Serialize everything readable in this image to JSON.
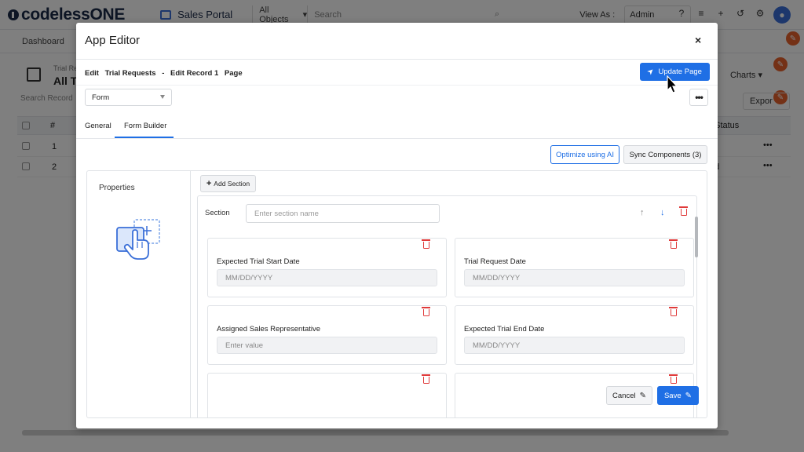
{
  "app": {
    "brand": "codelessONE",
    "app_name": "Sales Portal",
    "object_selector": "All Objects",
    "search_placeholder": "Search",
    "view_as_label": "View As :",
    "view_as_value": "Admin"
  },
  "nav": {
    "dashboard": "Dashboard"
  },
  "page": {
    "subtitle": "Trial Re",
    "title": "All Tr",
    "charts": "Charts",
    "search_placeholder": "Search Record",
    "export": "Expor",
    "columns": {
      "num": "#",
      "status": "t Status"
    },
    "rows": [
      {
        "num": "1",
        "status": "g"
      },
      {
        "num": "2",
        "status": "ed"
      }
    ]
  },
  "modal": {
    "title": "App Editor",
    "close": "×",
    "breadcrumb": [
      "Edit",
      "Trial Requests",
      "-",
      "Edit Record 1",
      "Page"
    ],
    "update_button": "Update Page",
    "form_select": "Form",
    "more": "•••",
    "tabs": [
      {
        "label": "General",
        "active": false
      },
      {
        "label": "Form Builder",
        "active": true
      }
    ],
    "optimize_button": "Optimize using AI",
    "sync_button": "Sync Components (3)",
    "properties_title": "Properties",
    "add_section": "Add Section",
    "section_label": "Section",
    "section_placeholder": "Enter section name",
    "fields": [
      {
        "label": "Expected Trial Start Date",
        "placeholder": "MM/DD/YYYY"
      },
      {
        "label": "Trial Request Date",
        "placeholder": "MM/DD/YYYY"
      },
      {
        "label": "Assigned Sales Representative",
        "placeholder": "Enter value"
      },
      {
        "label": "Expected Trial End Date",
        "placeholder": "MM/DD/YYYY"
      }
    ],
    "cancel_button": "Cancel",
    "save_button": "Save"
  },
  "colors": {
    "primary": "#1f6fe5",
    "danger": "#e03a3a",
    "accent_orange": "#e8622c"
  },
  "icons": [
    "rocket-icon",
    "trash-icon",
    "arrow-up-icon",
    "arrow-down-icon",
    "pencil-icon",
    "close-icon",
    "plus-icon",
    "touch-add-icon"
  ]
}
